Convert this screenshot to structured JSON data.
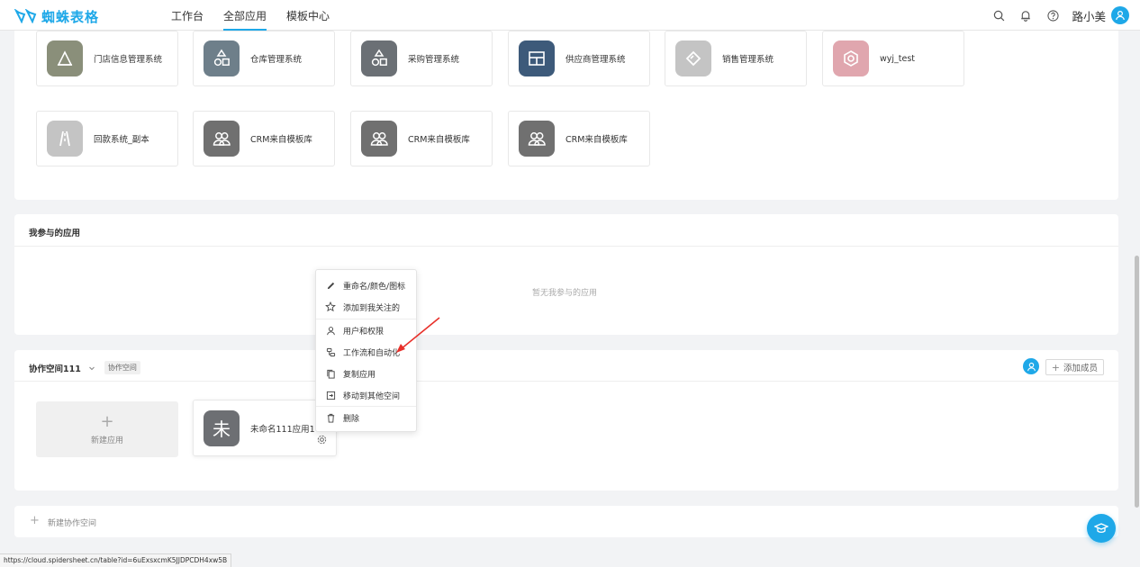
{
  "header": {
    "logo_text": "蜘蛛表格",
    "nav": [
      "工作台",
      "全部应用",
      "模板中心"
    ],
    "active_nav": 1,
    "user_name": "路小美"
  },
  "apps_top": [
    {
      "name": "门店信息管理系统",
      "color": "#8a8f7a"
    },
    {
      "name": "仓库管理系统",
      "color": "#6e7f8a"
    },
    {
      "name": "采购管理系统",
      "color": "#6b7075"
    },
    {
      "name": "供应商管理系统",
      "color": "#3d5a7a"
    },
    {
      "name": "销售管理系统",
      "color": "#c4c4c4"
    },
    {
      "name": "wyj_test",
      "color": "#e0a6ae"
    },
    {
      "name": "回款系统_副本",
      "color": "#c4c4c4"
    },
    {
      "name": "CRM来自模板库",
      "color": "#707070"
    },
    {
      "name": "CRM来自模板库",
      "color": "#707070"
    },
    {
      "name": "CRM来自模板库",
      "color": "#707070"
    }
  ],
  "participated": {
    "title": "我参与的应用",
    "empty_text": "暂无我参与的应用"
  },
  "workspace": {
    "name": "协作空间111",
    "tag": "协作空间",
    "add_member_label": "添加成员",
    "new_app_plus": "+",
    "new_app_label": "新建应用",
    "app": {
      "icon_char": "未",
      "name": "未命名111应用1"
    }
  },
  "context_menu": {
    "items": [
      {
        "label": "重命名/颜色/图标",
        "icon": "pencil-icon"
      },
      {
        "label": "添加到我关注的",
        "icon": "star-icon"
      },
      {
        "label": "用户和权限",
        "icon": "user-icon"
      },
      {
        "label": "工作流和自动化",
        "icon": "workflow-icon"
      },
      {
        "label": "复制应用",
        "icon": "copy-icon"
      },
      {
        "label": "移动到其他空间",
        "icon": "move-icon"
      },
      {
        "label": "删除",
        "icon": "trash-icon"
      }
    ]
  },
  "new_workspace": {
    "plus": "+",
    "label": "新建协作空间"
  },
  "status_url": "https://cloud.spidersheet.cn/table?id=6uExsxcmK5JJDPCDH4xw5B",
  "colors": {
    "accent": "#1ea8e8",
    "arrow": "#e8302a"
  }
}
